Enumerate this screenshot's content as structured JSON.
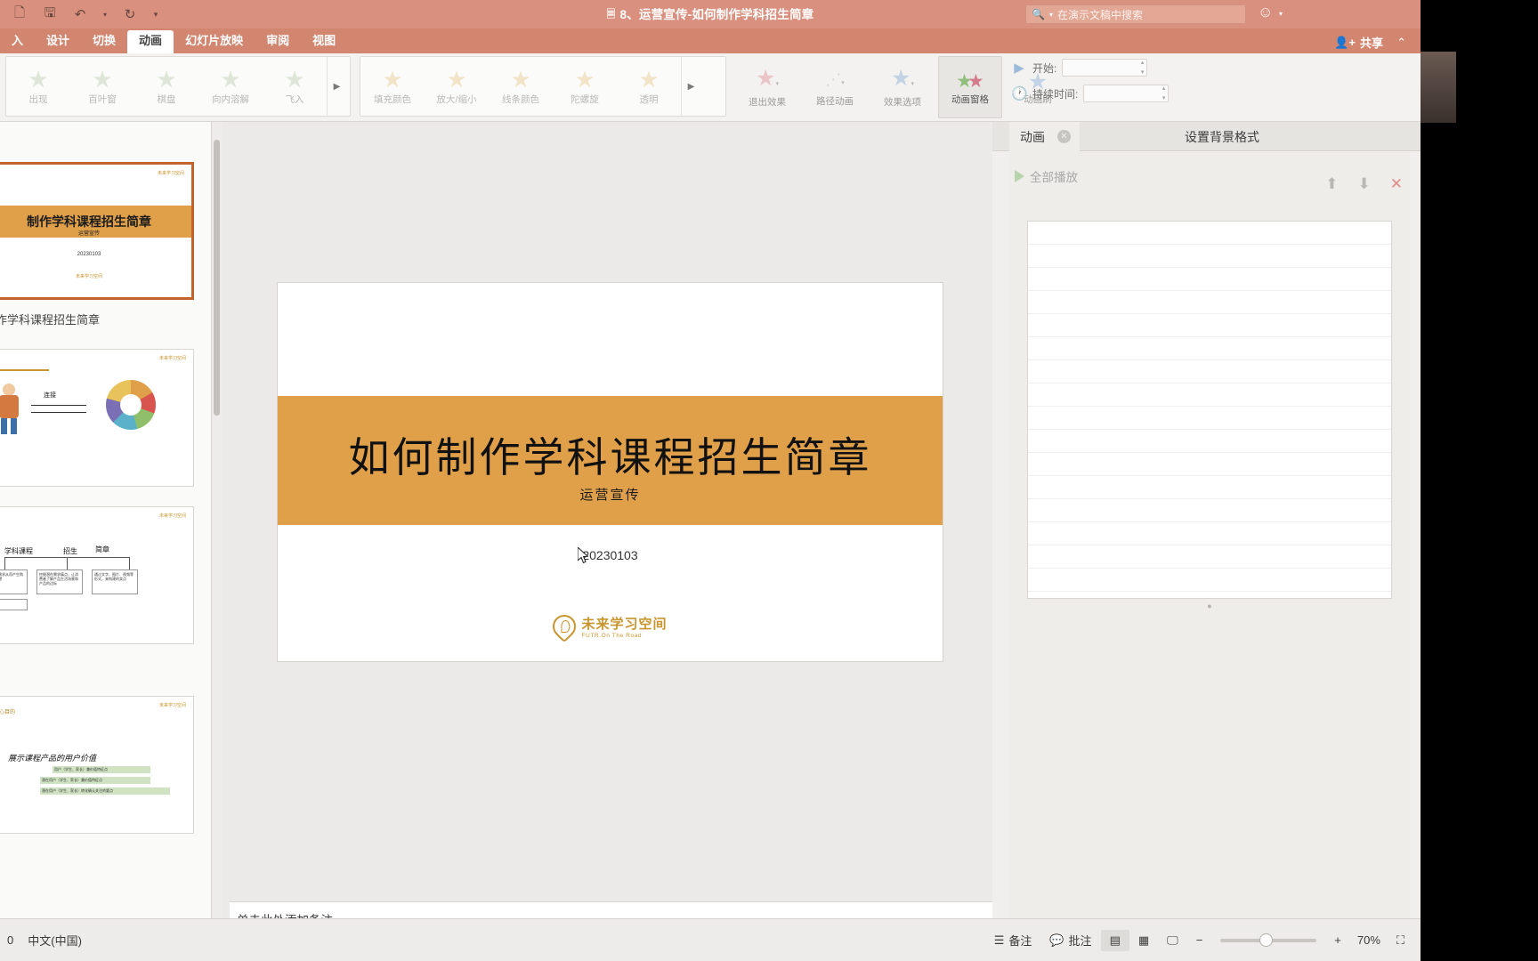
{
  "titlebar": {
    "document_title": "8、运营宣传-如何制作学科招生简章",
    "doc_icon": "document-icon",
    "quick_access": [
      {
        "name": "new-icon",
        "glyph": "🗋"
      },
      {
        "name": "save-icon",
        "glyph": "🖫"
      },
      {
        "name": "undo-icon",
        "glyph": "↶"
      },
      {
        "name": "undo-caret-icon",
        "glyph": "▾"
      },
      {
        "name": "redo-icon",
        "glyph": "↻"
      },
      {
        "name": "customize-caret-icon",
        "glyph": "▾"
      }
    ],
    "search": {
      "icon": "search-icon",
      "placeholder": "在演示文稿中搜索",
      "caret": "▾"
    },
    "emoji": {
      "icon": "smiley-icon",
      "glyph": "☺",
      "caret": "▾"
    }
  },
  "tabs": {
    "items": [
      {
        "label": "入",
        "active": false
      },
      {
        "label": "设计",
        "active": false
      },
      {
        "label": "切换",
        "active": false
      },
      {
        "label": "动画",
        "active": true
      },
      {
        "label": "幻灯片放映",
        "active": false
      },
      {
        "label": "审阅",
        "active": false
      },
      {
        "label": "视图",
        "active": false
      }
    ],
    "share_label": "共享",
    "share_icon": "share-person-icon",
    "collapse_icon": "chevron-up-icon"
  },
  "ribbon": {
    "entrance_gallery": [
      {
        "label": "出现",
        "color": "#b9cdb0"
      },
      {
        "label": "百叶窗",
        "color": "#b9cdb0"
      },
      {
        "label": "棋盘",
        "color": "#b9cdb0"
      },
      {
        "label": "向内溶解",
        "color": "#b9cdb0"
      },
      {
        "label": "飞入",
        "color": "#b9cdb0"
      }
    ],
    "emphasis_gallery": [
      {
        "label": "填充颜色",
        "color": "#e8c98d"
      },
      {
        "label": "放大/缩小",
        "color": "#e8c98d"
      },
      {
        "label": "线条颜色",
        "color": "#e8c98d"
      },
      {
        "label": "陀螺旋",
        "color": "#e8c98d"
      },
      {
        "label": "透明",
        "color": "#e8c98d"
      }
    ],
    "gallery_more_icon": "chevron-right-icon",
    "buttons": [
      {
        "label": "退出效果",
        "icon": "exit-effect-star-icon",
        "color": "#e4a0a8",
        "caret": "▾",
        "active": false
      },
      {
        "label": "路径动画",
        "icon": "motion-path-icon",
        "color": "#bdbdbd",
        "caret": "▾",
        "active": false
      },
      {
        "label": "效果选项",
        "icon": "effect-options-star-icon",
        "color": "#9cb9dd",
        "caret": "▾",
        "active": false
      },
      {
        "label": "动画窗格",
        "icon": "animation-pane-icon",
        "color": "#8fbf7a",
        "caret": "",
        "active": true
      },
      {
        "label": "动画刷",
        "icon": "animation-painter-icon",
        "color": "#9cb9dd",
        "caret": "",
        "active": false
      }
    ],
    "timing": {
      "start_icon": "play-icon",
      "start_label": "开始:",
      "start_value": "",
      "duration_icon": "clock-icon",
      "duration_label": "持续时间:",
      "duration_value": ""
    }
  },
  "thumbnails": {
    "slides": [
      {
        "index": "1",
        "selected": true,
        "title": "制作学科课程招生简章",
        "subtitle": "运营宣传",
        "date": "20230103",
        "logo": "未来学习空间"
      },
      {
        "index": "2",
        "selected": false,
        "connector_label": "连接",
        "logo": "未来学习空间"
      },
      {
        "index": "3",
        "selected": false,
        "headings": [
          "学科课程",
          "招生",
          "简章"
        ],
        "boxes": [
          "了解需求从而产生购买欲望",
          "挖掘潜在需求痛点，让消费者了解产品生活场景和产品的边际",
          "通过文字、图片、视频等形式，来构建的卖点"
        ],
        "logo": "未来学习空间"
      },
      {
        "index": "4",
        "selected": false,
        "corner_label": "核心目的",
        "main_line": "展示课程产品的用户价值",
        "highlights": [
          "用户（学生、家长）兼价值特征点",
          "潜在用户（学生、家长）兼价值特征点",
          "潜在用户（学生、家长）转化确认关注的要点"
        ],
        "logo": "未来学习空间"
      }
    ]
  },
  "slide": {
    "title": "如何制作学科课程招生简章",
    "subtitle": "运营宣传",
    "date": "20230103",
    "logo_main": "未来学习空间",
    "logo_sub": "FUTR.On The Road",
    "band_color": "#e0a04a",
    "cursor_icon": "mouse-pointer-icon"
  },
  "notes": {
    "placeholder": "单击此处添加备注"
  },
  "animation_pane": {
    "tabs": [
      {
        "label": "动画",
        "active": true,
        "close_icon": "close-circle-icon"
      },
      {
        "label": "设置背景格式",
        "active": false
      }
    ],
    "play_all_label": "全部播放",
    "play_icon": "play-triangle-icon",
    "toolbar_icons": [
      {
        "name": "move-up-icon",
        "glyph": "⬆"
      },
      {
        "name": "move-down-icon",
        "glyph": "⬇"
      },
      {
        "name": "delete-icon",
        "glyph": "✕"
      }
    ],
    "list_items": []
  },
  "statusbar": {
    "page_indicator": "0",
    "language": "中文(中国)",
    "notes_button": {
      "label": "备注",
      "icon": "notes-icon"
    },
    "comments_button": {
      "label": "批注",
      "icon": "comment-icon"
    },
    "views": [
      {
        "name": "normal-view-icon",
        "glyph": "▤",
        "active": true
      },
      {
        "name": "slide-sorter-icon",
        "glyph": "▦",
        "active": false
      },
      {
        "name": "reading-view-icon",
        "glyph": "🖵",
        "active": false
      }
    ],
    "zoom_out_icon": "minus-icon",
    "zoom_in_icon": "plus-icon",
    "zoom_level": "70%",
    "fit_icon": "fit-slide-icon"
  }
}
